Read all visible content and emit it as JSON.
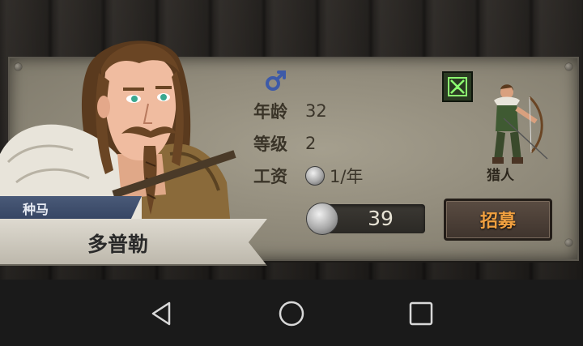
{
  "recruit": {
    "age_label": "年龄",
    "age_value": "32",
    "level_label": "等级",
    "level_value": "2",
    "wage_label": "工资",
    "wage_value": "1/年",
    "class_name": "猎人",
    "cost": "39",
    "recruit_button": "招募",
    "trait": "种马",
    "name": "多普勒"
  },
  "icons": {
    "gender": "male-symbol-icon",
    "class": "crossed-bow-icon",
    "currency": "silver-coin-icon"
  },
  "colors": {
    "gender_blue": "#3d5aa8",
    "recruit_text": "#f0a040",
    "class_icon_green": "#8cff70"
  },
  "nav": {
    "back": "back-icon",
    "home": "home-icon",
    "recents": "recents-icon"
  }
}
